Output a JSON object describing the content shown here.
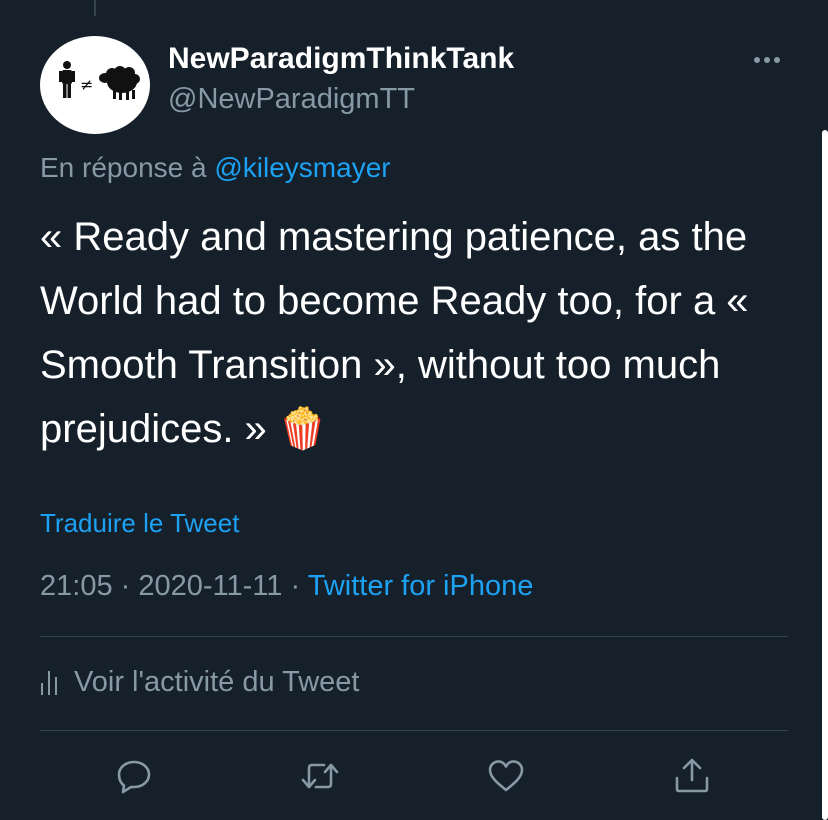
{
  "tweet": {
    "display_name": "NewParadigmThinkTank",
    "handle": "@NewParadigmTT",
    "reply_prefix": "En réponse à",
    "reply_mention": "@kileysmayer",
    "text": "« Ready and mastering patience, as the World had to become Ready too, for a « Smooth Transition », without too much prejudices. » 🍿",
    "translate_label": "Traduire le Tweet",
    "time": "21:05",
    "date": "2020-11-11",
    "separator": "·",
    "source": "Twitter for iPhone",
    "activity_label": "Voir l'activité du Tweet"
  },
  "avatar": {
    "symbol_not_equal": "≠"
  },
  "icons": {
    "more": "more-icon",
    "activity": "bar-chart-icon",
    "reply": "reply-icon",
    "retweet": "retweet-icon",
    "like": "like-icon",
    "share": "share-icon"
  },
  "colors": {
    "background": "#15202b",
    "text": "#ffffff",
    "secondary_text": "#8899a6",
    "link": "#1da1f2",
    "divider": "#38444d"
  }
}
